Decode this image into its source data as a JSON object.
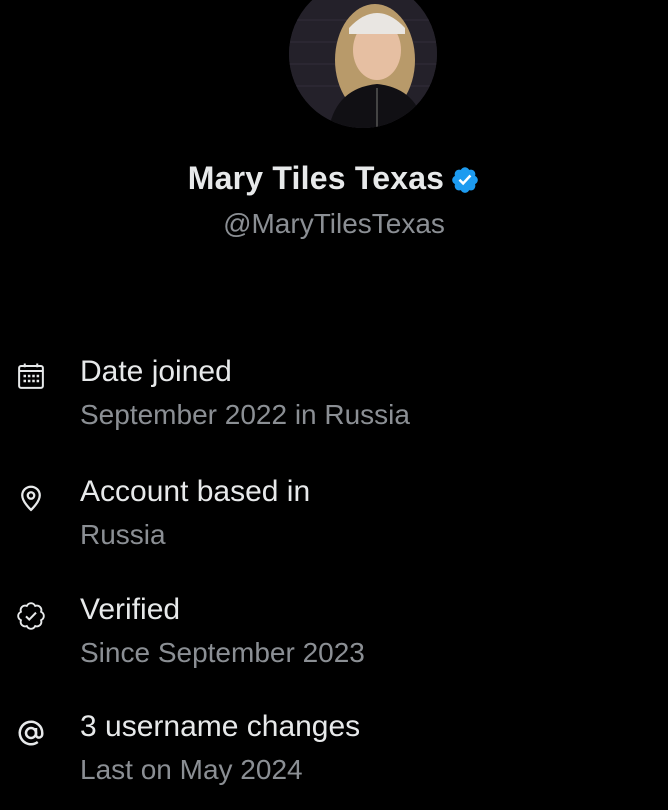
{
  "profile": {
    "display_name": "Mary Tiles Texas",
    "handle": "@MaryTilesTexas",
    "verified": true,
    "verified_badge_color": "#1d9bf0",
    "avatar_icon": "profile-photo"
  },
  "about": {
    "date_joined": {
      "icon": "calendar-icon",
      "label": "Date joined",
      "value": "September 2022 in Russia"
    },
    "location": {
      "icon": "location-pin-icon",
      "label": "Account based in",
      "value": "Russia"
    },
    "verified": {
      "icon": "verified-badge-outline-icon",
      "label": "Verified",
      "value": "Since September 2023"
    },
    "username_changes": {
      "icon": "at-sign-icon",
      "label": "3 username changes",
      "value": "Last on May 2024"
    }
  },
  "colors": {
    "background": "#000000",
    "primary_text": "#e7e9ea",
    "secondary_text": "#8b8f94"
  }
}
